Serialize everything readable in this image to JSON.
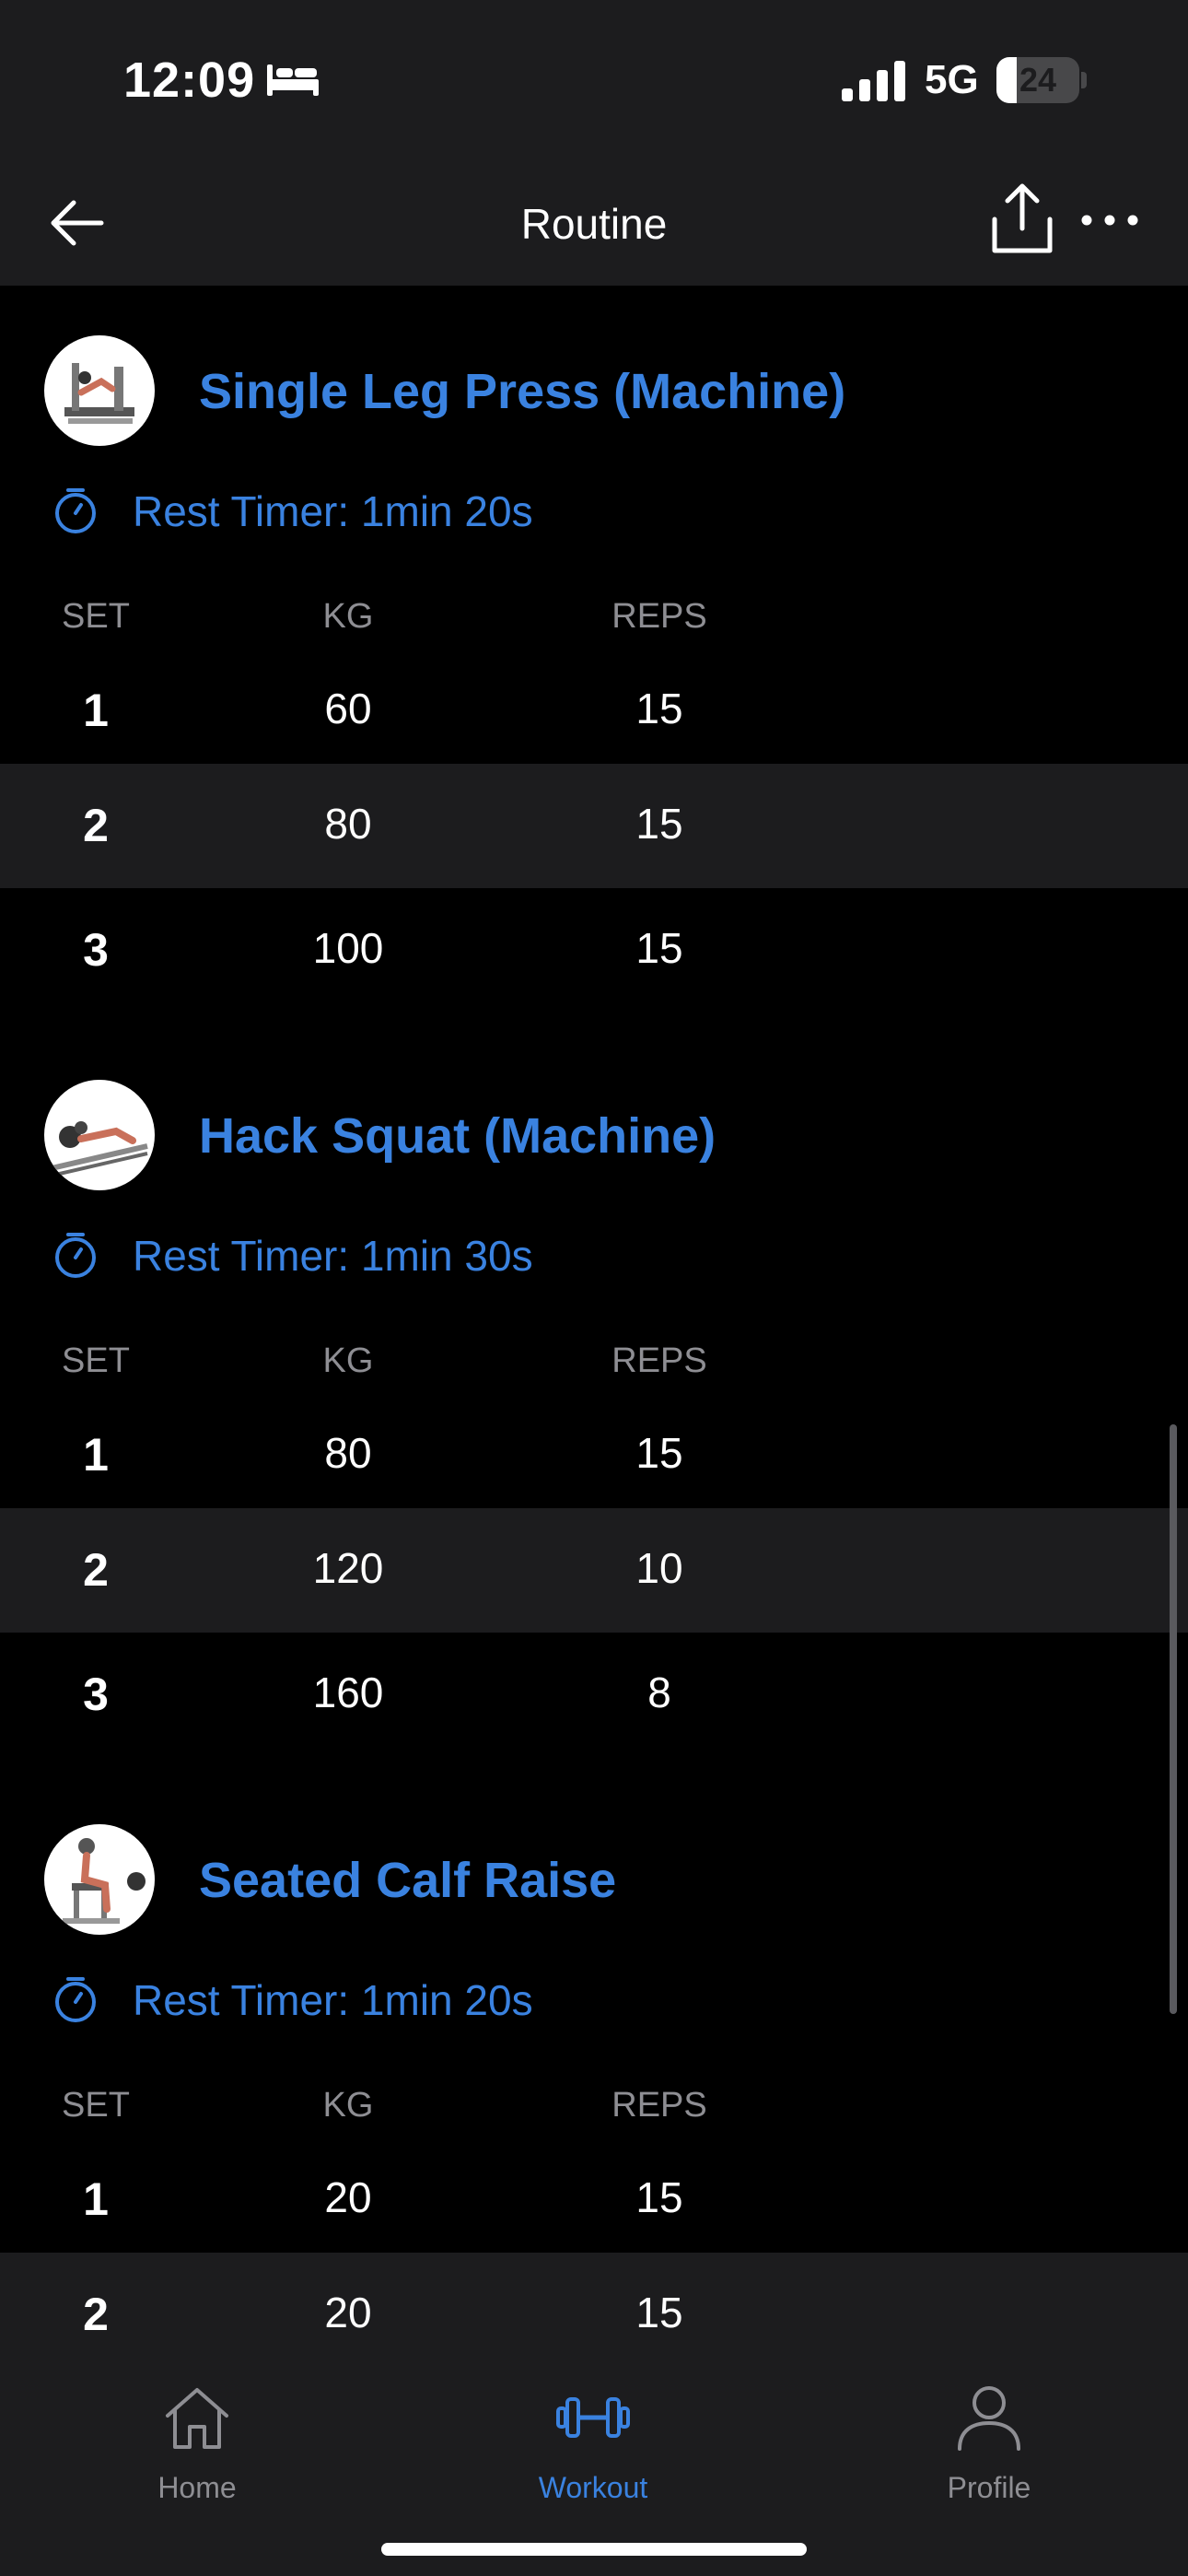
{
  "status_bar": {
    "time": "12:09",
    "network": "5G",
    "battery_percent": 24,
    "battery_label": "24"
  },
  "nav": {
    "title": "Routine"
  },
  "table_headers": {
    "set": "SET",
    "kg": "KG",
    "reps": "REPS"
  },
  "exercises": [
    {
      "name": "Single Leg Press (Machine)",
      "rest_timer": "Rest Timer: 1min 20s",
      "sets": [
        {
          "set": "1",
          "kg": "60",
          "reps": "15"
        },
        {
          "set": "2",
          "kg": "80",
          "reps": "15"
        },
        {
          "set": "3",
          "kg": "100",
          "reps": "15"
        }
      ]
    },
    {
      "name": "Hack Squat (Machine)",
      "rest_timer": "Rest Timer: 1min 30s",
      "sets": [
        {
          "set": "1",
          "kg": "80",
          "reps": "15"
        },
        {
          "set": "2",
          "kg": "120",
          "reps": "10"
        },
        {
          "set": "3",
          "kg": "160",
          "reps": "8"
        }
      ]
    },
    {
      "name": "Seated Calf Raise",
      "rest_timer": "Rest Timer: 1min 20s",
      "sets": [
        {
          "set": "1",
          "kg": "20",
          "reps": "15"
        },
        {
          "set": "2",
          "kg": "20",
          "reps": "15"
        }
      ]
    }
  ],
  "tab_bar": {
    "tabs": [
      {
        "label": "Home",
        "icon": "home-icon"
      },
      {
        "label": "Workout",
        "icon": "dumbbell-icon",
        "active": true
      },
      {
        "label": "Profile",
        "icon": "person-icon"
      }
    ]
  },
  "colors": {
    "accent": "#3a82e0",
    "background": "#000000",
    "surface": "#1c1c1e",
    "muted": "#8e8e93"
  }
}
